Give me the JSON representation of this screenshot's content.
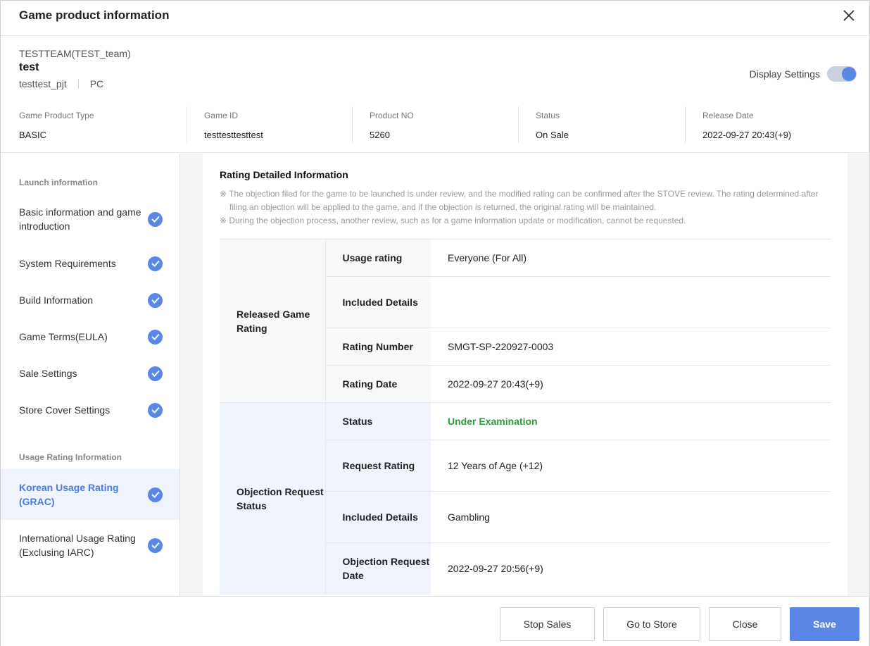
{
  "header": {
    "title": "Game product information"
  },
  "product": {
    "team": "TESTTEAM(TEST_team)",
    "name": "test",
    "project": "testtest_pjt",
    "platform": "PC",
    "display_label": "Display Settings"
  },
  "meta": [
    {
      "label": "Game Product Type",
      "value": "BASIC"
    },
    {
      "label": "Game ID",
      "value": "testtesttesttest"
    },
    {
      "label": "Product NO",
      "value": "5260"
    },
    {
      "label": "Status",
      "value": "On Sale"
    },
    {
      "label": "Release Date",
      "value": "2022-09-27 20:43(+9)"
    }
  ],
  "sidebar": {
    "launch_heading": "Launch information",
    "launch_items": [
      {
        "label": "Basic information and game introduction"
      },
      {
        "label": "System Requirements"
      },
      {
        "label": "Build Information"
      },
      {
        "label": "Game Terms(EULA)"
      },
      {
        "label": "Sale Settings"
      },
      {
        "label": "Store Cover Settings"
      }
    ],
    "rating_heading": "Usage Rating Information",
    "rating_items": [
      {
        "label": "Korean Usage Rating (GRAC)"
      },
      {
        "label": "International Usage Rating (Exclusing IARC)"
      }
    ]
  },
  "content": {
    "title": "Rating Detailed Information",
    "notes": [
      "※ The objection filed for the game to be launched is under review, and the modified rating can be confirmed after the STOVE review. The rating determined after filing an objection will be applied to the game, and if the objection is returned, the original rating will be maintained.",
      "※ During the objection process, another review, such as for a game information update or modification, cannot be requested."
    ],
    "released": {
      "group": "Released Game Rating",
      "rows": [
        {
          "key": "Usage rating",
          "value": "Everyone (For All)"
        },
        {
          "key": "Included Details",
          "value": ""
        },
        {
          "key": "Rating Number",
          "value": "SMGT-SP-220927-0003"
        },
        {
          "key": "Rating Date",
          "value": "2022-09-27 20:43(+9)"
        }
      ]
    },
    "objection": {
      "group": "Objection Request Status",
      "rows": [
        {
          "key": "Status",
          "value": "Under Examination"
        },
        {
          "key": "Request Rating",
          "value": "12 Years of Age (+12)"
        },
        {
          "key": "Included Details",
          "value": "Gambling"
        },
        {
          "key": "Objection Request Date",
          "value": "2022-09-27 20:56(+9)"
        }
      ]
    }
  },
  "footer": {
    "stop_sales": "Stop Sales",
    "go_to_store": "Go to Store",
    "close": "Close",
    "save": "Save"
  },
  "colors": {
    "accent": "#5b86e5",
    "status_green": "#2e9a3e"
  }
}
